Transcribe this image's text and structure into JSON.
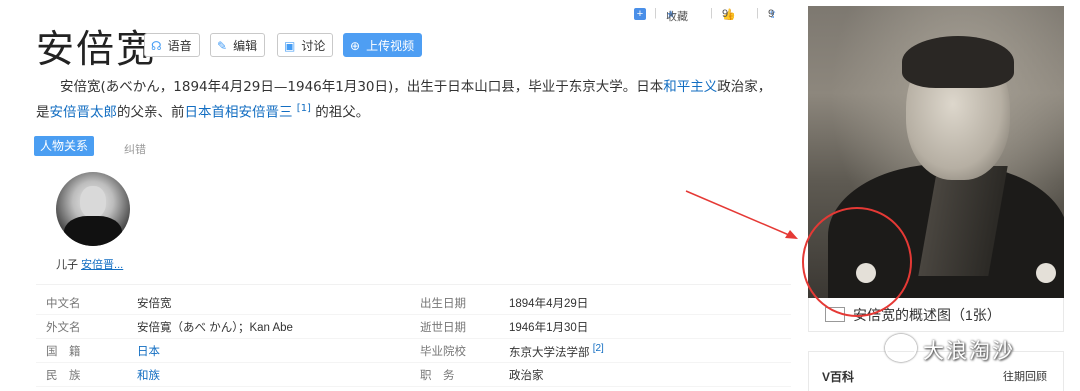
{
  "page": {
    "title": "安倍宽",
    "buttons": {
      "voice": "语音",
      "edit": "编辑",
      "discuss": "讨论",
      "upload": "上传视频"
    },
    "actions": {
      "favorite": "收藏",
      "likes": "9",
      "shares": "9"
    },
    "summary": {
      "p1": "安倍宽(あべかん，1894年4月29日—1946年1月30日)，出生于日本山口县，毕业于东京大学。日本",
      "link1": "和平主义",
      "p2": "政治家，是",
      "link2": "安倍晋太郎",
      "p3": "的父亲、前",
      "link3": "日本首相安倍晋三",
      "ref": "[1]",
      "p4": "的祖父。"
    },
    "relation": {
      "tag": "人物关系",
      "muted": "纠错",
      "role": "儿子",
      "name": "安倍晋..."
    },
    "infobox": {
      "left": [
        {
          "label": "中文名",
          "value": "安倍宽"
        },
        {
          "label": "外文名",
          "value": "安倍寛（あべ かん）；Kan Abe"
        },
        {
          "label": "国　籍",
          "value": "日本"
        },
        {
          "label": "民　族",
          "value": "和族"
        }
      ],
      "right": [
        {
          "label": "出生日期",
          "value": "1894年4月29日"
        },
        {
          "label": "逝世日期",
          "value": "1946年1月30日"
        },
        {
          "label": "毕业院校",
          "value": "东京大学法学部",
          "ref": "[2]"
        },
        {
          "label": "职　务",
          "value": "政治家"
        }
      ]
    },
    "photo_caption": "安倍宽的概述图（1张）",
    "vbaike": {
      "title": "V百科",
      "link": "往期回顾"
    },
    "watermark": "大浪淘沙",
    "colors": {
      "link": "#136ec2",
      "accent": "#4e9ef3",
      "annotation": "#e53935"
    }
  }
}
